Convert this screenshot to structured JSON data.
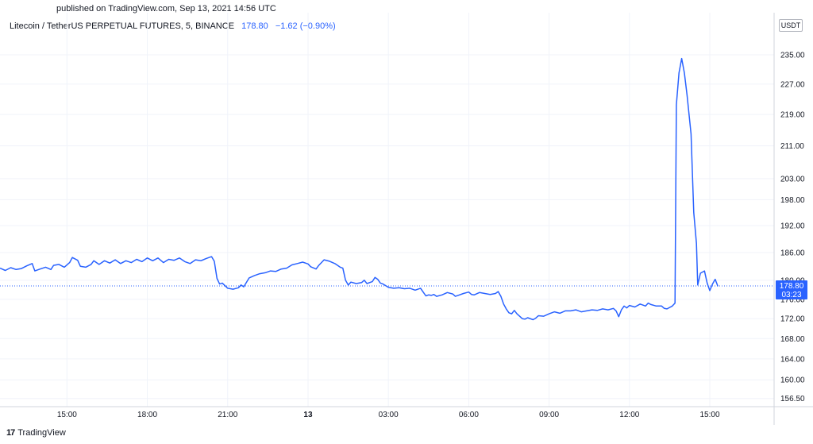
{
  "header": {
    "published": "published on TradingView.com, Sep 13, 2021 14:56 UTC",
    "symbol": "Litecoin / TetherUS PERPETUAL FUTURES, 5, BINANCE",
    "last_price": "178.80",
    "change": "−1.62 (−0.90%)"
  },
  "currency_badge": "USDT",
  "brand": {
    "logo_text": "17",
    "name": "TradingView"
  },
  "price_label": {
    "price": "178.80",
    "countdown": "03:23"
  },
  "colors": {
    "line": "#2962ff",
    "label_bg": "#2962ff",
    "grid": "#f0f3fa",
    "axis": "#d1d4dc"
  },
  "chart_data": {
    "type": "line",
    "scale": "log",
    "ylim": [
      155,
      247
    ],
    "y_ticks": [
      156.5,
      160,
      164,
      168,
      172,
      176,
      180,
      186,
      192,
      198,
      203,
      211,
      219,
      227,
      235
    ],
    "x_ticks": [
      {
        "label": "15:00",
        "t": 2.0
      },
      {
        "label": "18:00",
        "t": 5.0
      },
      {
        "label": "21:00",
        "t": 8.0
      },
      {
        "label": "13",
        "t": 11.0
      },
      {
        "label": "03:00",
        "t": 14.0
      },
      {
        "label": "06:00",
        "t": 17.0
      },
      {
        "label": "09:00",
        "t": 20.0
      },
      {
        "label": "12:00",
        "t": 23.0
      },
      {
        "label": "15:00",
        "t": 26.0
      }
    ],
    "x_range": [
      -0.5,
      28.4
    ],
    "current_value": 178.8,
    "series": [
      {
        "points": [
          [
            -0.5,
            182.6
          ],
          [
            -0.3,
            182.1
          ],
          [
            -0.1,
            182.7
          ],
          [
            0.1,
            182.3
          ],
          [
            0.3,
            182.5
          ],
          [
            0.5,
            183.1
          ],
          [
            0.7,
            183.6
          ],
          [
            0.8,
            182.0
          ],
          [
            1.0,
            182.4
          ],
          [
            1.2,
            182.8
          ],
          [
            1.4,
            182.3
          ],
          [
            1.5,
            183.2
          ],
          [
            1.7,
            183.4
          ],
          [
            1.9,
            182.8
          ],
          [
            2.1,
            183.8
          ],
          [
            2.2,
            184.9
          ],
          [
            2.4,
            184.3
          ],
          [
            2.5,
            183.0
          ],
          [
            2.7,
            182.8
          ],
          [
            2.9,
            183.4
          ],
          [
            3.0,
            184.2
          ],
          [
            3.2,
            183.4
          ],
          [
            3.4,
            184.2
          ],
          [
            3.6,
            183.7
          ],
          [
            3.8,
            184.4
          ],
          [
            4.0,
            183.6
          ],
          [
            4.2,
            184.2
          ],
          [
            4.4,
            183.8
          ],
          [
            4.6,
            184.5
          ],
          [
            4.8,
            184.0
          ],
          [
            5.0,
            184.8
          ],
          [
            5.2,
            184.2
          ],
          [
            5.4,
            184.8
          ],
          [
            5.6,
            183.8
          ],
          [
            5.8,
            184.5
          ],
          [
            6.0,
            184.3
          ],
          [
            6.2,
            184.8
          ],
          [
            6.4,
            184.0
          ],
          [
            6.6,
            183.6
          ],
          [
            6.8,
            184.4
          ],
          [
            7.0,
            184.2
          ],
          [
            7.2,
            184.7
          ],
          [
            7.4,
            185.1
          ],
          [
            7.5,
            184.1
          ],
          [
            7.6,
            180.4
          ],
          [
            7.7,
            179.2
          ],
          [
            7.8,
            179.4
          ],
          [
            8.0,
            178.3
          ],
          [
            8.2,
            178.1
          ],
          [
            8.4,
            178.4
          ],
          [
            8.5,
            179.0
          ],
          [
            8.6,
            178.6
          ],
          [
            8.8,
            180.5
          ],
          [
            9.0,
            181.0
          ],
          [
            9.2,
            181.4
          ],
          [
            9.4,
            181.6
          ],
          [
            9.6,
            182.0
          ],
          [
            9.8,
            181.9
          ],
          [
            10.0,
            182.4
          ],
          [
            10.2,
            182.6
          ],
          [
            10.4,
            183.3
          ],
          [
            10.6,
            183.6
          ],
          [
            10.8,
            183.9
          ],
          [
            11.0,
            183.5
          ],
          [
            11.1,
            182.9
          ],
          [
            11.3,
            182.4
          ],
          [
            11.4,
            183.2
          ],
          [
            11.6,
            184.4
          ],
          [
            11.8,
            184.1
          ],
          [
            12.0,
            183.6
          ],
          [
            12.2,
            182.8
          ],
          [
            12.3,
            182.6
          ],
          [
            12.4,
            180.0
          ],
          [
            12.5,
            179.0
          ],
          [
            12.6,
            179.6
          ],
          [
            12.8,
            179.3
          ],
          [
            13.0,
            179.5
          ],
          [
            13.1,
            180.0
          ],
          [
            13.2,
            179.3
          ],
          [
            13.4,
            179.7
          ],
          [
            13.5,
            180.6
          ],
          [
            13.6,
            180.2
          ],
          [
            13.7,
            179.4
          ],
          [
            13.8,
            179.2
          ],
          [
            14.0,
            178.5
          ],
          [
            14.2,
            178.3
          ],
          [
            14.4,
            178.4
          ],
          [
            14.6,
            178.2
          ],
          [
            14.8,
            178.3
          ],
          [
            15.0,
            177.9
          ],
          [
            15.2,
            178.3
          ],
          [
            15.3,
            177.5
          ],
          [
            15.4,
            176.7
          ],
          [
            15.5,
            176.9
          ],
          [
            15.6,
            176.8
          ],
          [
            15.7,
            177.0
          ],
          [
            15.8,
            176.6
          ],
          [
            16.0,
            176.9
          ],
          [
            16.2,
            177.4
          ],
          [
            16.4,
            177.1
          ],
          [
            16.5,
            176.6
          ],
          [
            16.6,
            176.8
          ],
          [
            16.8,
            177.2
          ],
          [
            17.0,
            177.5
          ],
          [
            17.1,
            177.0
          ],
          [
            17.2,
            176.9
          ],
          [
            17.4,
            177.4
          ],
          [
            17.6,
            177.2
          ],
          [
            17.8,
            177.0
          ],
          [
            18.0,
            177.2
          ],
          [
            18.1,
            177.6
          ],
          [
            18.2,
            176.6
          ],
          [
            18.3,
            175.0
          ],
          [
            18.4,
            174.0
          ],
          [
            18.5,
            173.2
          ],
          [
            18.6,
            173.0
          ],
          [
            18.7,
            173.7
          ],
          [
            18.8,
            173.0
          ],
          [
            19.0,
            172.0
          ],
          [
            19.1,
            171.9
          ],
          [
            19.2,
            172.2
          ],
          [
            19.4,
            171.8
          ],
          [
            19.5,
            172.1
          ],
          [
            19.6,
            172.6
          ],
          [
            19.8,
            172.5
          ],
          [
            20.0,
            173.0
          ],
          [
            20.2,
            173.4
          ],
          [
            20.4,
            173.1
          ],
          [
            20.6,
            173.6
          ],
          [
            20.8,
            173.6
          ],
          [
            21.0,
            173.8
          ],
          [
            21.2,
            173.4
          ],
          [
            21.4,
            173.6
          ],
          [
            21.6,
            173.8
          ],
          [
            21.8,
            173.7
          ],
          [
            22.0,
            174.0
          ],
          [
            22.2,
            173.8
          ],
          [
            22.4,
            174.1
          ],
          [
            22.5,
            173.6
          ],
          [
            22.6,
            172.4
          ],
          [
            22.7,
            173.8
          ],
          [
            22.8,
            174.6
          ],
          [
            22.9,
            174.2
          ],
          [
            23.0,
            174.7
          ],
          [
            23.2,
            174.4
          ],
          [
            23.4,
            175.0
          ],
          [
            23.6,
            174.6
          ],
          [
            23.7,
            175.2
          ],
          [
            23.8,
            174.9
          ],
          [
            24.0,
            174.6
          ],
          [
            24.2,
            174.6
          ],
          [
            24.3,
            174.1
          ],
          [
            24.4,
            174.0
          ],
          [
            24.6,
            174.6
          ],
          [
            24.7,
            175.2
          ],
          [
            24.75,
            221.5
          ],
          [
            24.85,
            230.0
          ],
          [
            24.95,
            234.0
          ],
          [
            25.05,
            230.0
          ],
          [
            25.15,
            224.0
          ],
          [
            25.3,
            214.0
          ],
          [
            25.4,
            195.0
          ],
          [
            25.5,
            188.0
          ],
          [
            25.55,
            179.0
          ],
          [
            25.65,
            181.5
          ],
          [
            25.8,
            182.0
          ],
          [
            25.9,
            179.4
          ],
          [
            26.0,
            177.8
          ],
          [
            26.1,
            179.2
          ],
          [
            26.2,
            180.2
          ],
          [
            26.3,
            178.7
          ]
        ]
      }
    ]
  }
}
